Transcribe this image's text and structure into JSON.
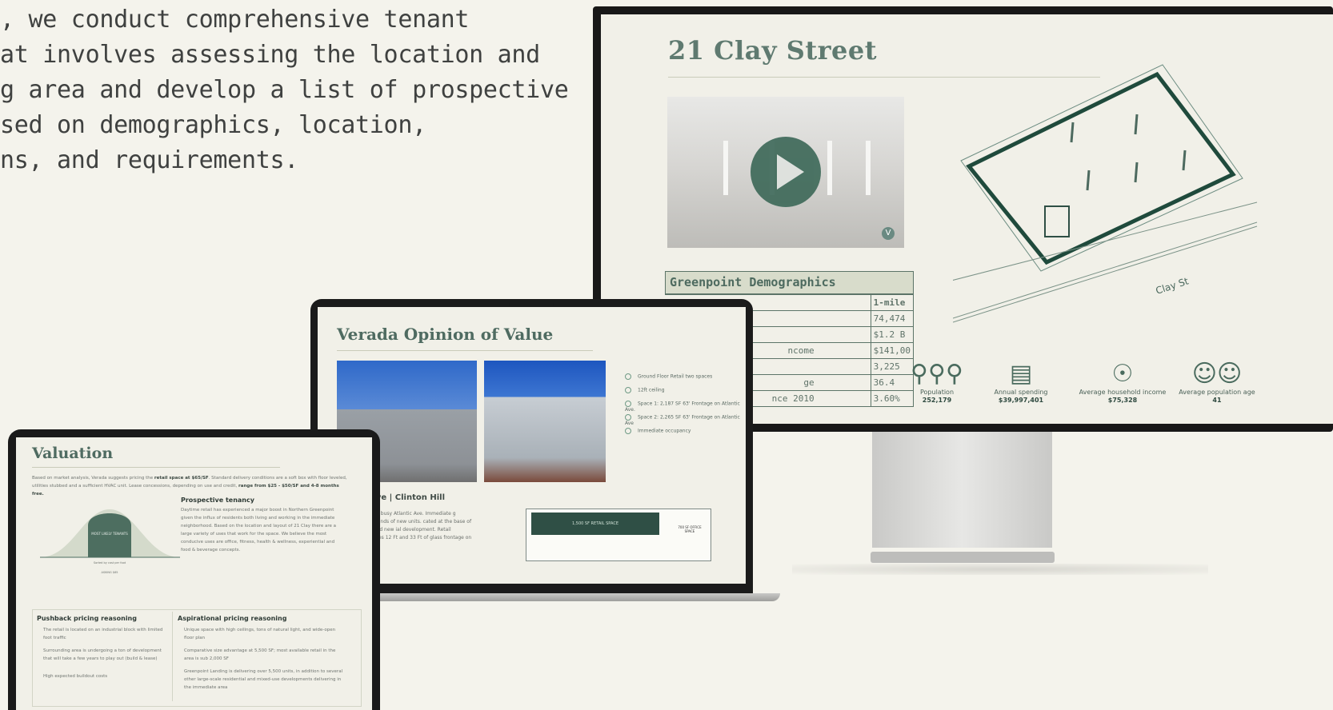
{
  "intro": {
    "lines": [
      ", we conduct comprehensive tenant",
      "at involves assessing the location and",
      "g area and develop a list of prospective",
      "sed on demographics, location,",
      "ns, and requirements."
    ]
  },
  "monitor": {
    "title": "21 Clay Street",
    "video_logo": "V",
    "street_label": "Clay St",
    "demographics": {
      "heading": "Greenpoint Demographics",
      "rows": [
        {
          "label": "",
          "value": "1-mile"
        },
        {
          "label": "",
          "value": "74,474"
        },
        {
          "label": "",
          "value": "$1.2 B"
        },
        {
          "label": "ncome",
          "value": "$141,00"
        },
        {
          "label": "",
          "value": "3,225"
        },
        {
          "label": "ge",
          "value": "36.4"
        },
        {
          "label": "nce 2010",
          "value": "3.60%"
        }
      ]
    },
    "stats": [
      {
        "icon": "people-icon",
        "label": "Population",
        "value": "252,179"
      },
      {
        "icon": "money-icon",
        "label": "Annual spending",
        "value": "$39,997,401"
      },
      {
        "icon": "dollar-icon",
        "label": "Average household income",
        "value": "$75,328"
      },
      {
        "icon": "person-icon",
        "label": "Average population age",
        "value": "41"
      }
    ]
  },
  "laptop": {
    "title": "Verada Opinion of Value",
    "bullets": [
      "Ground Floor Retail two spaces",
      "12ft ceiling",
      "Space 1: 2,187 SF 63' Frontage on Atlantic Ave.",
      "Space 2: 2,265 SF 63' Frontage on Atlantic Ave",
      "Immediate occupancy"
    ],
    "address": ": Ave | Clinton Hill",
    "paragraph": "Hill on busy Atlantic Ave. Immediate g thousands of new units. cated at the base of a brand new ial development. Retail features 12 Ft and 33 Ft of glass frontage on busy",
    "plan_retail": "1,500 SF RETAIL SPACE",
    "plan_office": "700 SF OFFICE SPACE"
  },
  "tablet": {
    "title": "Valuation",
    "intro_a": "Based on market analysis, Verada suggests pricing the ",
    "intro_bold": "retail space at $65/SF",
    "intro_b": ". Standard delivery conditions are a soft box with floor leveled, utilities stubbed and a sufficient HVAC unit. Lease concessions, depending on use and credit, ",
    "intro_bold2": "range from $25 - $50/SF and 4-8 months free.",
    "bell_label": "MOST LIKELY TENANTS",
    "bell_axis": "Sorted by cost per foot",
    "bell_price": "ASKING $65",
    "tenancy_head": "Prospective tenancy",
    "tenancy_text": "Daytime retail has experienced a major boost in Northern Greenpoint given the influx of residents both living and working in the immediate neighborhood. Based on the location and layout of 21 Clay there are a large variety of uses that work for the space. We believe the most conducive uses are office, fitness, health & wellness, experiential and food & beverage concepts.",
    "pushback_head": "Pushback pricing reasoning",
    "pushback": [
      "The retail is located on an industrial block with limited foot traffic",
      "Surrounding area is undergoing a ton of development that will take a few years to play out (build & lease)",
      "High expected buildout costs"
    ],
    "aspirational_head": "Aspirational pricing reasoning",
    "aspirational": [
      "Unique space with high ceilings, tons of natural light, and wide-open floor plan",
      "Comparative size advantage at 5,500 SF; most available retail in the area is sub 2,000 SF",
      "Greenpoint Landing is delivering over 5,500 units, in addition to several other large-scale residential and mixed-use developments delivering in the immediate area"
    ]
  }
}
